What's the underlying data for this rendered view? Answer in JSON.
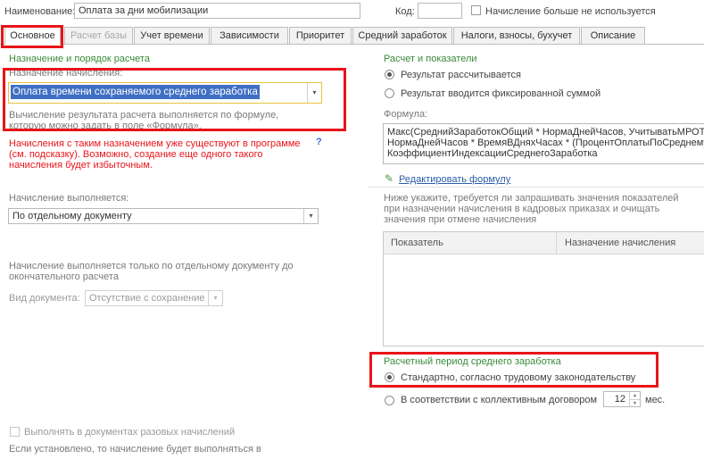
{
  "header": {
    "name_label": "Наименование:",
    "name_value": "Оплата за дни мобилизации",
    "code_label": "Код:",
    "code_value": "",
    "unused_checkbox_label": "Начисление больше не используется"
  },
  "tabs": [
    {
      "label": "Основное",
      "state": "active"
    },
    {
      "label": "Расчет базы",
      "state": "disabled"
    },
    {
      "label": "Учет времени",
      "state": "normal"
    },
    {
      "label": "Зависимости",
      "state": "normal"
    },
    {
      "label": "Приоритет",
      "state": "normal"
    },
    {
      "label": "Средний заработок",
      "state": "normal"
    },
    {
      "label": "Налоги, взносы, бухучет",
      "state": "normal"
    },
    {
      "label": "Описание",
      "state": "normal"
    }
  ],
  "left": {
    "section_title": "Назначение и порядок расчета",
    "purpose_label": "Назначение начисления:",
    "purpose_value": "Оплата времени сохраняемого среднего заработка",
    "purpose_hint_1": "Вычисление результата расчета выполняется по формуле,",
    "purpose_hint_2": "которую можно задать в поле «Формула».",
    "warning_1": "Начисления с таким назначением уже существуют в программе",
    "warning_2": "(см. подсказку). Возможно, создание еще одного такого",
    "warning_3": "начисления будет избыточным.",
    "help_mark": "?",
    "executed_label": "Начисление выполняется:",
    "executed_value": "По отдельному документу",
    "executed_hint_1": "Начисление выполняется только по отдельному документу до",
    "executed_hint_2": "окончательного расчета",
    "doc_type_label": "Вид документа:",
    "doc_type_value": "Отсутствие с сохранение",
    "one_time_checkbox_label": "Выполнять в документах разовых начислений",
    "one_time_hint": "Если установлено, то начисление будет выполняться в"
  },
  "right": {
    "section_title": "Расчет и показатели",
    "radio_calculated": "Результат рассчитывается",
    "radio_fixed": "Результат вводится фиксированной суммой",
    "formula_label": "Формула:",
    "formula_line_1": "Макс(СреднийЗаработокОбщий * НормаДнейЧасов, УчитыватьМРОТ",
    "formula_line_2": "НормаДнейЧасов * ВремяВДняхЧасах * (ПроцентОплатыПоСреднему",
    "formula_line_3": "КоэффициентИндексацииСреднегоЗаработка",
    "edit_formula_link": "Редактировать формулу",
    "indicators_hint_1": "Ниже укажите, требуется ли запрашивать значения показателей",
    "indicators_hint_2": "при назначении начисления в кадровых приказах и очищать",
    "indicators_hint_3": "значения при отмене начисления",
    "grid_col_1": "Показатель",
    "grid_col_2": "Назначение начисления",
    "period_title": "Расчетный период среднего заработка",
    "period_standard": "Стандартно, согласно трудовому законодательству",
    "period_collective": "В соответствии с коллективным договором",
    "period_months_value": "12",
    "period_months_unit": "мес."
  },
  "colors": {
    "highlight_box": "#e8141a",
    "section_title": "#3a8a3a",
    "warning_text": "#e8141a",
    "selection_bg": "#3f6fc4",
    "dropdown_focus_border": "#e6c33d",
    "link": "#2d5fa8"
  }
}
